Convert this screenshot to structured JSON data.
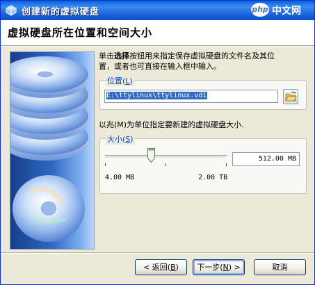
{
  "window": {
    "title": "创建新的虚拟硬盘",
    "watermark": {
      "logo": "php",
      "text": "中文网"
    }
  },
  "header": {
    "title": "虚拟硬盘所在位置和空间大小"
  },
  "description": {
    "line1_prefix": "单击",
    "line1_bold": "选择",
    "line1_suffix": "按钮用来指定保存虚拟硬盘的文件名及其位",
    "line2": "置，或者也可直接在输入框中输入。"
  },
  "location": {
    "legend": "位置",
    "legend_hotkey": "L",
    "path_value": "E:\\ttylinux\\ttylinux.vdi",
    "browse_icon": "folder-open-icon"
  },
  "size_description": "以兆(M)为单位指定要新建的虚拟硬盘大小.",
  "size": {
    "legend": "大小",
    "legend_hotkey": "S",
    "value": "512.00 MB",
    "slider_fraction": 0.38,
    "min_label": "4.00 MB",
    "max_label": "2.00 TB"
  },
  "buttons": {
    "back": {
      "label": "< 返回",
      "hotkey": "B"
    },
    "next": {
      "label": "下一步",
      "hotkey": "N",
      "suffix": ">"
    },
    "cancel": {
      "label": "取消"
    }
  },
  "colors": {
    "titlebar": "#0a5fd8",
    "legend_text": "#0046d5",
    "selection": "#316ac5",
    "dialog_bg": "#ece9d8"
  }
}
